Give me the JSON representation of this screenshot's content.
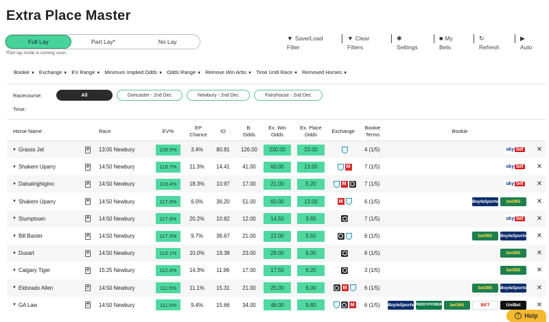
{
  "app": {
    "title": "Extra Place Master"
  },
  "lay_modes": {
    "options": [
      "Full Lay",
      "Part Lay*",
      "No Lay"
    ],
    "active": 0,
    "note": "*Part lay mode is coming soon."
  },
  "toolbar": {
    "items": [
      {
        "line1": "Save/Load",
        "line2": "Filter",
        "icon": "filter-icon"
      },
      {
        "line1": "Clear",
        "line2": "Filters",
        "icon": "filter-clear-icon"
      },
      {
        "line1": "",
        "line2": "Settings",
        "icon": "gear-icon"
      },
      {
        "line1": "My",
        "line2": "Bets",
        "icon": "save-icon"
      },
      {
        "line1": "",
        "line2": "Refresh",
        "icon": "refresh-icon"
      },
      {
        "line1": "",
        "line2": "Auto",
        "icon": "play-icon"
      }
    ]
  },
  "filters": [
    "Bookie",
    "Exchange",
    "EV Range",
    "Minimum Implied Odds",
    "Odds Range",
    "Remove Win Arbs",
    "Time Until Race",
    "Removed Horses"
  ],
  "racecourse": {
    "label": "Racecourse:",
    "time_label": "Time:",
    "chips": [
      "All",
      "Doncaster - 2nd Dec",
      "Newbury - 2nd Dec",
      "Fairyhouse - 2nd Dec"
    ]
  },
  "table": {
    "headers": {
      "horse": "Horse Name",
      "race": "Race",
      "ev": "EV%",
      "ep_1": "EP",
      "ep_2": "Chance",
      "io": "IO",
      "b_1": "B.",
      "b_2": "Odds",
      "exw_1": "Ex. Win",
      "exw_2": "Odds",
      "exp_1": "Ex. Place",
      "exp_2": "Odds",
      "exchange": "Exchange",
      "terms_1": "Bookie",
      "terms_2": "Terms",
      "bookie": "Bookie"
    },
    "rows": [
      {
        "horse": "Grasss Jet",
        "race": "13:05 Newbury",
        "ev": "128.5%",
        "ep": "3.4%",
        "io": "80.81",
        "b_odds": "126.00",
        "ex_win": "230.00",
        "ex_place": "23.00",
        "exchanges": [
          "shield"
        ],
        "terms": "4 (1/5)",
        "bookies": [
          "sky"
        ]
      },
      {
        "horse": "Shakem Uparry",
        "race": "14:50 Newbury",
        "ev": "119.7%",
        "ep": "11.3%",
        "io": "14.41",
        "b_odds": "41.00",
        "ex_win": "60.00",
        "ex_place": "13.00",
        "exchanges": [
          "shield",
          "m"
        ],
        "terms": "7 (1/5)",
        "bookies": [
          "sky"
        ]
      },
      {
        "horse": "Datsalrightgino",
        "race": "14:50 Newbury",
        "ev": "119.4%",
        "ep": "18.3%",
        "io": "10.97",
        "b_odds": "17.00",
        "ex_win": "21.00",
        "ex_place": "5.20",
        "exchanges": [
          "shield",
          "m",
          "o"
        ],
        "terms": "7 (1/5)",
        "bookies": [
          "sky"
        ]
      },
      {
        "horse": "Shakem Uparry",
        "race": "14:50 Newbury",
        "ev": "117.9%",
        "ep": "6.0%",
        "io": "36.20",
        "b_odds": "51.00",
        "ex_win": "60.00",
        "ex_place": "13.00",
        "exchanges": [
          "m",
          "shield"
        ],
        "terms": "6 (1/5)",
        "bookies": [
          "boyle",
          "b365"
        ]
      },
      {
        "horse": "Stumptown",
        "race": "14:50 Newbury",
        "ev": "117.6%",
        "ep": "20.2%",
        "io": "10.82",
        "b_odds": "12.00",
        "ex_win": "14.50",
        "ex_place": "3.65",
        "exchanges": [
          "o"
        ],
        "terms": "7 (1/5)",
        "bookies": [
          "sky"
        ]
      },
      {
        "horse": "Bill Baxter",
        "race": "14:50 Newbury",
        "ev": "117.3%",
        "ep": "9.7%",
        "io": "36.67",
        "b_odds": "21.00",
        "ex_win": "22.00",
        "ex_place": "5.50",
        "exchanges": [
          "o",
          "shield"
        ],
        "terms": "6 (1/5)",
        "bookies": [
          "b365",
          "boyle"
        ]
      },
      {
        "horse": "Dusart",
        "race": "14:50 Newbury",
        "ev": "113.1%",
        "ep": "10.0%",
        "io": "19.38",
        "b_odds": "23.00",
        "ex_win": "28.00",
        "ex_place": "6.00",
        "exchanges": [
          "o"
        ],
        "terms": "6 (1/5)",
        "bookies": [
          "b365"
        ]
      },
      {
        "horse": "Calgary Tiger",
        "race": "15:25 Newbury",
        "ev": "112.4%",
        "ep": "14.3%",
        "io": "11.96",
        "b_odds": "17.00",
        "ex_win": "17.50",
        "ex_place": "6.20",
        "exchanges": [
          "o"
        ],
        "terms": "3 (1/5)",
        "bookies": [
          "b365"
        ]
      },
      {
        "horse": "Eldorado Allen",
        "race": "14:50 Newbury",
        "ev": "111.5%",
        "ep": "11.1%",
        "io": "15.31",
        "b_odds": "21.00",
        "ex_win": "25.00",
        "ex_place": "6.00",
        "exchanges": [
          "o",
          "m",
          "shield"
        ],
        "terms": "6 (1/5)",
        "bookies": [
          "b365",
          "boyle"
        ]
      },
      {
        "horse": "GA Law",
        "race": "14:50 Newbury",
        "ev": "111.5%",
        "ep": "9.4%",
        "io": "15.66",
        "b_odds": "34.00",
        "ex_win": "46.00",
        "ex_place": "9.80",
        "exchanges": [
          "shield",
          "o",
          "m"
        ],
        "terms": "6 (1/5)",
        "bookies": [
          "boyle",
          "paddy",
          "b365",
          "virgin",
          "unibet"
        ]
      }
    ]
  },
  "bookie_labels": {
    "sky": "sky",
    "sky_bet": "bet",
    "b365": "bet365",
    "boyle": "BoyleSports",
    "paddy": "PADDYPOWER",
    "virgin": "BET",
    "unibet": "UniBet"
  },
  "help": {
    "label": "Help"
  },
  "colors": {
    "accent": "#4fd9a1",
    "help": "#f5b82e"
  }
}
